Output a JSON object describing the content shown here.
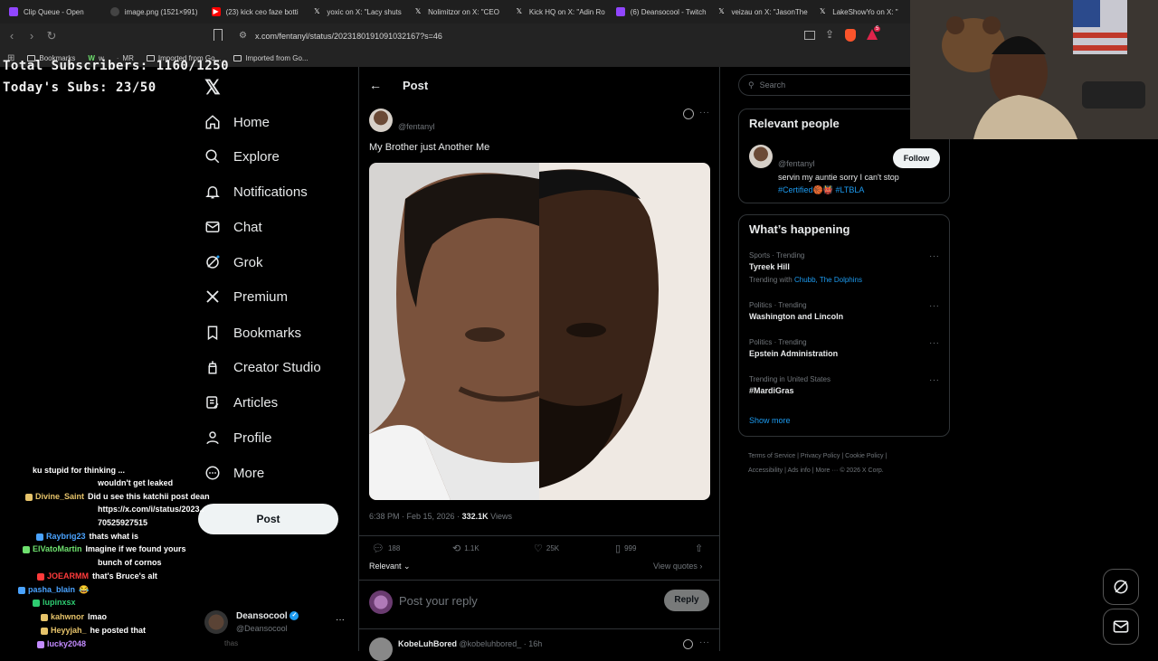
{
  "browser": {
    "tabs": [
      {
        "title": "Clip Queue - Open",
        "color": "#9146ff"
      },
      {
        "title": "image.png (1521×991)",
        "color": "#444444"
      },
      {
        "title": "(23) kick ceo faze botti",
        "color": "#ff0000"
      },
      {
        "title": "yoxic on X: \"Lacy shuts",
        "color": "#000000"
      },
      {
        "title": "Nolimitzor on X: \"CEO",
        "color": "#000000"
      },
      {
        "title": "Kick HQ on X: \"Adin Ro",
        "color": "#000000"
      },
      {
        "title": "(6) Deansocool - Twitch",
        "color": "#9146ff"
      },
      {
        "title": "veizau on X: \"JasonThe",
        "color": "#000000"
      },
      {
        "title": "LakeShowYo on X: \"",
        "color": "#000000"
      }
    ],
    "url": "x.com/fentanyl/status/2023180191091032167?s=46",
    "bookmarks": [
      "Bookmarks",
      "w",
      "MR",
      "Imported from Go...",
      "Imported from Go..."
    ],
    "extension_badge": "5"
  },
  "overlay": {
    "total_subs": "Total Subscribers: 1160/1250",
    "today_subs": "Today's Subs: 23/50"
  },
  "nav": {
    "items": [
      "Home",
      "Explore",
      "Notifications",
      "Chat",
      "Grok",
      "Premium",
      "Bookmarks",
      "Creator Studio",
      "Articles",
      "Profile",
      "More"
    ],
    "post_button": "Post",
    "account_name": "Deansocool",
    "account_handle": "@Deansocool",
    "account_sub": "thas"
  },
  "post": {
    "header": "Post",
    "handle": "@fentanyl",
    "text": "My Brother just Another Me",
    "timestamp": "6:38 PM · Feb 15, 2026 ·",
    "views_count": "332.1K",
    "views_label": "Views",
    "replies": "188",
    "reposts": "1.1K",
    "likes": "25K",
    "bookmarks": "999",
    "sort": "Relevant",
    "view_quotes": "View quotes",
    "reply_placeholder": "Post your reply",
    "reply_button": "Reply",
    "next_reply_name": "KobeLuhBored",
    "next_reply_handle": "@kobeluhbored_ · 16h"
  },
  "right": {
    "search_placeholder": "Search",
    "relevant_title": "Relevant people",
    "person_handle": "@fentanyl",
    "follow": "Follow",
    "bio": "servin my auntie sorry I can't stop",
    "bio_tags": "#Certified",
    "bio_tags2": "#LTBLA",
    "happening_title": "What’s happening",
    "trends": [
      {
        "meta": "Sports · Trending",
        "name": "Tyreek Hill",
        "with_label": "Trending with",
        "with": "Chubb, The Dolphins"
      },
      {
        "meta": "Politics · Trending",
        "name": "Washington and Lincoln"
      },
      {
        "meta": "Politics · Trending",
        "name": "Epstein Administration"
      },
      {
        "meta": "Trending in United States",
        "name": "#MardiGras"
      }
    ],
    "show_more": "Show more",
    "footer": [
      "Terms of Service",
      "Privacy Policy",
      "Cookie Policy",
      "Accessibility",
      "Ads info",
      "More ···",
      "© 2026 X Corp."
    ]
  },
  "chat": [
    {
      "user": "",
      "msg": "ku stupid for thinking ...",
      "color": "#ffffff"
    },
    {
      "user": "",
      "msg": "wouldn't get leaked",
      "color": "#ffffff"
    },
    {
      "user": "Divine_Saint",
      "msg": "Did u see this katchii post dean",
      "color": "#e6c36a"
    },
    {
      "user": "",
      "msg": "https://x.com/i/status/2023..",
      "color": "#ffffff"
    },
    {
      "user": "",
      "msg": "70525927515",
      "color": "#ffffff"
    },
    {
      "user": "Raybrig23",
      "msg": "thats what is",
      "color": "#4aa3ff"
    },
    {
      "user": "ElVatoMartin",
      "msg": "Imagine if we found yours",
      "color": "#6ee06e"
    },
    {
      "user": "",
      "msg": "bunch of cornos",
      "color": "#ffffff"
    },
    {
      "user": "JOEARMM",
      "msg": "that's Bruce's alt",
      "color": "#ff3b3b"
    },
    {
      "user": "pasha_blain",
      "msg": "😂",
      "color": "#4aa3ff"
    },
    {
      "user": "lupinxsx",
      "msg": "",
      "color": "#2ecc71"
    },
    {
      "user": "kahwnor",
      "msg": "lmao",
      "color": "#e6c36a"
    },
    {
      "user": "Heyyjah_",
      "msg": "he posted that",
      "color": "#e6c36a"
    },
    {
      "user": "lucky2048",
      "msg": "",
      "color": "#c38bff"
    }
  ]
}
